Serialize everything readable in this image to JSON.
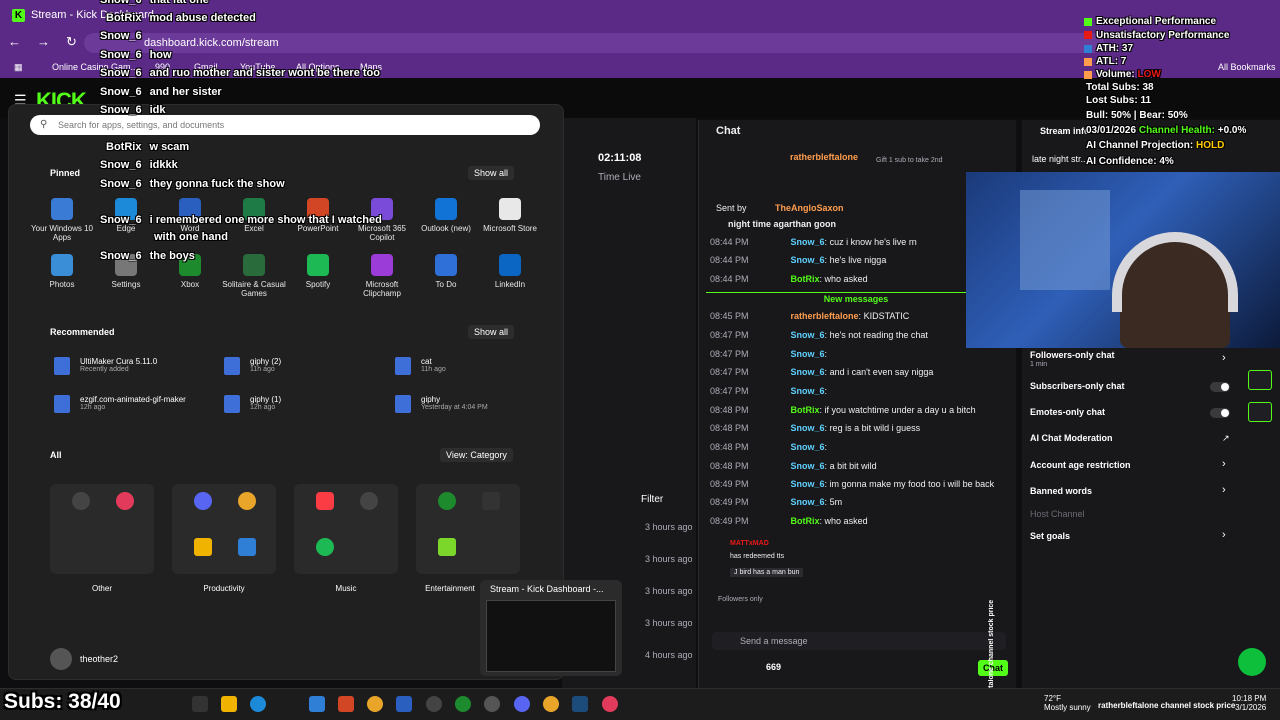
{
  "browser": {
    "tab_title": "Stream - Kick Dashboard",
    "address": "dashboard.kick.com/stream",
    "bookmarks": [
      "Online Casino Gam...",
      "990",
      "Gmail",
      "YouTube",
      "All Options",
      "Maps"
    ],
    "all_bookmarks": "All Bookmarks"
  },
  "kick": {
    "logo": "KICK",
    "time_value": "02:11:08",
    "time_label": "Time Live",
    "filter_label": "Filter",
    "ago_items": [
      "3 hours ago",
      "3 hours ago",
      "3 hours ago",
      "3 hours ago",
      "4 hours ago"
    ],
    "stream_info_label": "Stream info",
    "stream_title_snip": "late night str..."
  },
  "chat": {
    "title": "Chat",
    "gift_user": "ratherbleftalone",
    "gift_text": "Gift 1 sub to take 2nd",
    "sent_by_label": "Sent by",
    "sent_by_user": "TheAngloSaxon",
    "pinned_text": "night time agarthan goon",
    "new_messages": "New messages",
    "messages": [
      {
        "time": "08:44 PM",
        "user": "Snow_6",
        "text": "cuz i know he's live rn"
      },
      {
        "time": "08:44 PM",
        "user": "Snow_6",
        "text": "he's live nigga"
      },
      {
        "time": "08:44 PM",
        "user": "BotRix",
        "text": "who asked"
      },
      {
        "time": "08:45 PM",
        "user": "ratherbleftalone",
        "text": "KIDSTATIC"
      },
      {
        "time": "08:47 PM",
        "user": "Snow_6",
        "text": "he's not reading the chat"
      },
      {
        "time": "08:47 PM",
        "user": "Snow_6",
        "text": ""
      },
      {
        "time": "08:47 PM",
        "user": "Snow_6",
        "text": "and i can't even say nigga"
      },
      {
        "time": "08:47 PM",
        "user": "Snow_6",
        "text": ""
      },
      {
        "time": "08:48 PM",
        "user": "BotRix",
        "text": "if you watchtime under a day u a bitch"
      },
      {
        "time": "08:48 PM",
        "user": "Snow_6",
        "text": "reg is a bit wild i guess"
      },
      {
        "time": "08:48 PM",
        "user": "Snow_6",
        "text": ""
      },
      {
        "time": "08:48 PM",
        "user": "Snow_6",
        "text": "a bit bit wild"
      },
      {
        "time": "08:49 PM",
        "user": "Snow_6",
        "text": "im gonna make my food too i will be back"
      },
      {
        "time": "08:49 PM",
        "user": "Snow_6",
        "text": "5m"
      },
      {
        "time": "08:49 PM",
        "user": "BotRix",
        "text": "who asked"
      }
    ],
    "redeem_user": "MATTxMAD",
    "redeem_text": "has redeemed tts",
    "redeem_msg": "J bird has a man bun",
    "followers_only": "Followers only",
    "send_placeholder": "Send a message",
    "viewer_count": "669",
    "chat_button": "Chat",
    "vertical_text": "ratherbleftalone channel stock price history"
  },
  "settings": {
    "followers_only": "Followers-only chat",
    "followers_sub": "1 min",
    "subscribers_only": "Subscribers-only chat",
    "emotes_only": "Emotes-only chat",
    "ai_moderation": "AI Chat Moderation",
    "age_restriction": "Account age restriction",
    "banned_words": "Banned words",
    "host_channel": "Host Channel",
    "set_goals": "Set goals"
  },
  "overlay_chat": [
    {
      "user": "Snow_6",
      "text": "that fat one"
    },
    {
      "user": "BotRix",
      "text": "mod abuse detected"
    },
    {
      "user": "Snow_6",
      "text": ""
    },
    {
      "user": "Snow_6",
      "text": "how"
    },
    {
      "user": "Snow_6",
      "text": "and ruo mother and sister wont be there too"
    },
    {
      "user": "Snow_6",
      "text": "and her sister"
    },
    {
      "user": "Snow_6",
      "text": "idk"
    },
    {
      "user": "BotRix",
      "text": "w scam"
    },
    {
      "user": "Snow_6",
      "text": "idkkk"
    },
    {
      "user": "Snow_6",
      "text": "they gonna fuck the show"
    },
    {
      "user": "Snow_6",
      "text": "i remembered one more show that I watched"
    },
    {
      "user": "",
      "text": "with one hand"
    },
    {
      "user": "Snow_6",
      "text": "the boys"
    }
  ],
  "stats": {
    "legend_green": "Exceptional Performance",
    "legend_red": "Unsatisfactory Performance",
    "ath": "ATH: 37",
    "atl": "ATL: 7",
    "volume_label": "Volume:",
    "volume_value": "LOW",
    "total_subs": "Total Subs: 38",
    "lost_subs": "Lost Subs: 11",
    "bull_bear": "Bull: 50% | Bear: 50%",
    "date": "03/01/2026",
    "channel_health_label": "Channel Health:",
    "channel_health_value": "+0.0%",
    "projection_label": "AI Channel Projection:",
    "projection_value": "HOLD",
    "confidence": "AI Confidence: 4%"
  },
  "start_menu": {
    "search_placeholder": "Search for apps, settings, and documents",
    "pinned": "Pinned",
    "show_all": "Show all",
    "pinned_apps": [
      {
        "label": "Your Windows 10 Apps",
        "color": "#3a7bd5"
      },
      {
        "label": "Edge",
        "color": "#1c8ad8"
      },
      {
        "label": "Word",
        "color": "#2b5fbf"
      },
      {
        "label": "Excel",
        "color": "#1e7b45"
      },
      {
        "label": "PowerPoint",
        "color": "#d24625"
      },
      {
        "label": "Microsoft 365 Copilot",
        "color": "#7a4bd8"
      },
      {
        "label": "Outlook (new)",
        "color": "#1273d6"
      },
      {
        "label": "Microsoft Store",
        "color": "#e8e8e8"
      },
      {
        "label": "Photos",
        "color": "#3a8ed8"
      },
      {
        "label": "Settings",
        "color": "#777777"
      },
      {
        "label": "Xbox",
        "color": "#1e8a2e"
      },
      {
        "label": "Solitaire & Casual Games",
        "color": "#2a6b3c"
      },
      {
        "label": "Spotify",
        "color": "#1db954"
      },
      {
        "label": "Microsoft Clipchamp",
        "color": "#9b3bd8"
      },
      {
        "label": "To Do",
        "color": "#2e6fd8"
      },
      {
        "label": "LinkedIn",
        "color": "#0a66c2"
      }
    ],
    "recommended": "Recommended",
    "recommended_items": [
      {
        "name": "UltiMaker Cura 5.11.0",
        "sub": "Recently added"
      },
      {
        "name": "giphy (2)",
        "sub": "11h ago"
      },
      {
        "name": "cat",
        "sub": "11h ago"
      },
      {
        "name": "ezgif.com-animated-gif-maker",
        "sub": "12h ago"
      },
      {
        "name": "giphy (1)",
        "sub": "12h ago"
      },
      {
        "name": "giphy",
        "sub": "Yesterday at 4:04 PM"
      }
    ],
    "all": "All",
    "view_category": "View: Category",
    "categories": [
      "Other",
      "Productivity",
      "Music",
      "Entertainment"
    ],
    "user_name": "theother2"
  },
  "taskbar": {
    "subs_overlay": "Subs: 38/40",
    "search_label": "Search",
    "preview_title": "Stream - Kick Dashboard -...",
    "weather_temp": "72°F",
    "weather_desc": "Mostly sunny",
    "tray_name": "ratherbleftalone channel stock price",
    "time": "10:18 PM",
    "date": "3/1/2026"
  },
  "colors": {
    "kick_green": "#53fc18",
    "browser_purple": "#5b2a86",
    "panel_bg": "#18181b"
  }
}
